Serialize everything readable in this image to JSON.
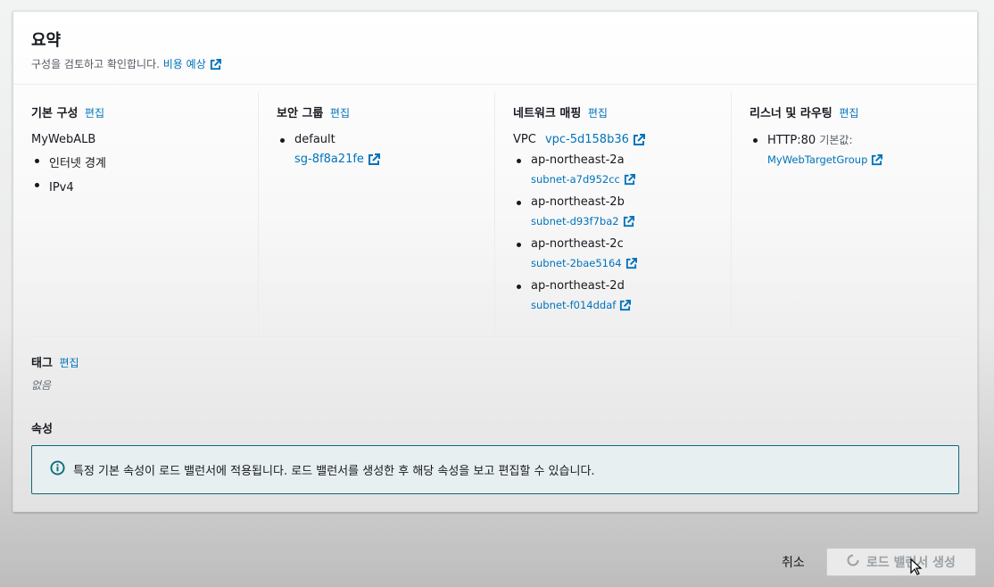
{
  "summary": {
    "title": "요약",
    "description": "구성을 검토하고 확인합니다.",
    "cost_link": "비용 예상"
  },
  "basic": {
    "heading": "기본 구성",
    "edit": "편집",
    "name": "MyWebALB",
    "items": [
      "인터넷 경계",
      "IPv4"
    ]
  },
  "security": {
    "heading": "보안 그룹",
    "edit": "편집",
    "group_name": "default",
    "group_id": "sg-8f8a21fe"
  },
  "network": {
    "heading": "네트워크 매핑",
    "edit": "편집",
    "vpc_label": "VPC",
    "vpc_id": "vpc-5d158b36",
    "zones": [
      {
        "az": "ap-northeast-2a",
        "subnet": "subnet-a7d952cc"
      },
      {
        "az": "ap-northeast-2b",
        "subnet": "subnet-d93f7ba2"
      },
      {
        "az": "ap-northeast-2c",
        "subnet": "subnet-2bae5164"
      },
      {
        "az": "ap-northeast-2d",
        "subnet": "subnet-f014ddaf"
      }
    ]
  },
  "listener": {
    "heading": "리스너 및 라우팅",
    "edit": "편집",
    "protocol": "HTTP:80",
    "default_label": "기본값:",
    "target_group": "MyWebTargetGroup"
  },
  "tags": {
    "heading": "태그",
    "edit": "편집",
    "empty": "없음"
  },
  "attributes": {
    "heading": "속성",
    "info": "특정 기본 속성이 로드 밸런서에 적용됩니다. 로드 밸런서를 생성한 후 해당 속성을 보고 편집할 수 있습니다."
  },
  "footer": {
    "cancel": "취소",
    "create": "로드 밸런서 생성"
  },
  "colors": {
    "link": "#0073bb",
    "info_border": "#0b6b7d"
  },
  "icons": [
    "external-link-icon",
    "info-icon",
    "spinner-icon",
    "mouse-cursor-icon"
  ]
}
